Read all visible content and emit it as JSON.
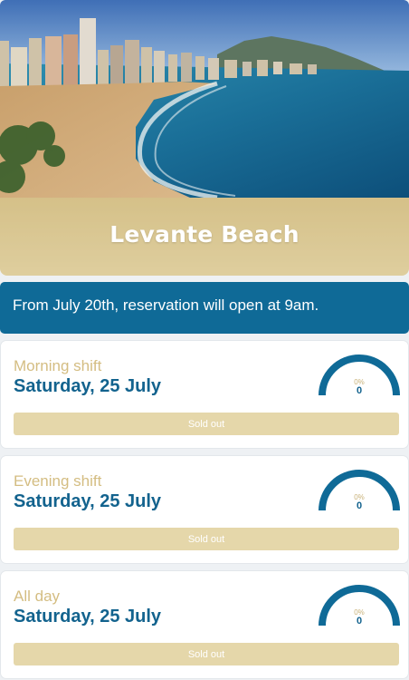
{
  "hero": {
    "title": "Levante Beach"
  },
  "notice": {
    "text": "From July 20th, reservation will open at 9am."
  },
  "shifts": [
    {
      "name": "Morning shift",
      "date": "Saturday, 25 July",
      "percent_label": "0%",
      "count": "0",
      "button_label": "Sold out"
    },
    {
      "name": "Evening shift",
      "date": "Saturday, 25 July",
      "percent_label": "0%",
      "count": "0",
      "button_label": "Sold out"
    },
    {
      "name": "All day",
      "date": "Saturday, 25 July",
      "percent_label": "0%",
      "count": "0",
      "button_label": "Sold out"
    }
  ],
  "colors": {
    "brand_blue": "#0f6a97",
    "sand": "#e5d7aa",
    "sand_text": "#d4bd82",
    "date_blue": "#13638e"
  }
}
